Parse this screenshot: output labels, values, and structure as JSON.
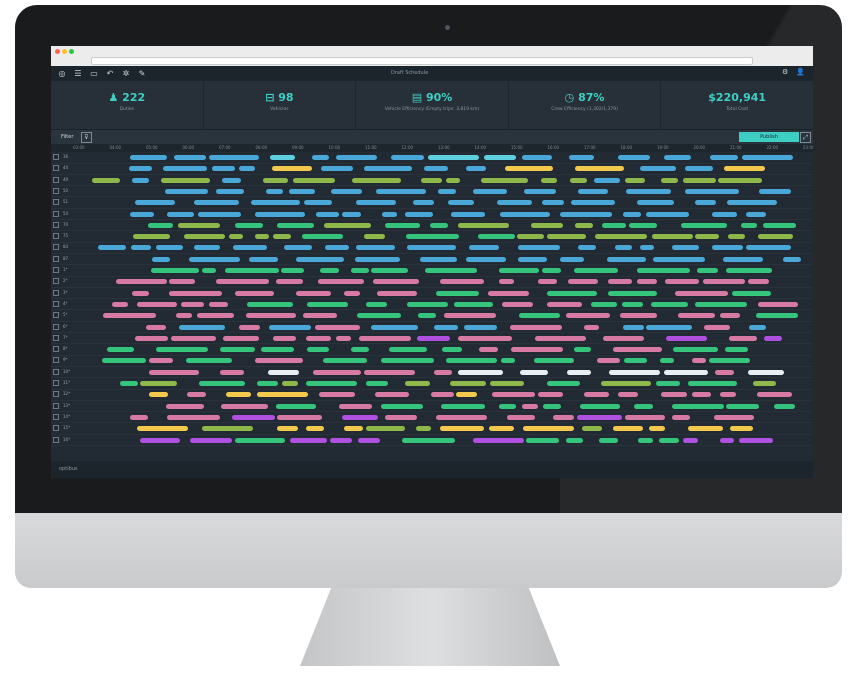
{
  "app": {
    "title": "Draft Schedule",
    "footer_brand": "optibus"
  },
  "toolbar": {
    "icons": [
      "logo-icon",
      "menu-icon",
      "folder-icon",
      "undo-icon",
      "settings-icon",
      "edit-icon"
    ],
    "right_icons": [
      "gear-icon",
      "user-icon"
    ]
  },
  "stats": [
    {
      "value": "222",
      "label": "Duties",
      "icon": "duty-icon"
    },
    {
      "value": "98",
      "label": "Vehicles",
      "icon": "bus-icon"
    },
    {
      "value": "90%",
      "label": "Vehicle Efficiency (Empty trips: 3,819 km)",
      "icon": "gauge-icon"
    },
    {
      "value": "87%",
      "label": "Crew Efficiency (1,302/1,379)",
      "icon": "clock-icon"
    },
    {
      "value": "$220,941",
      "label": "Total Cost",
      "icon": ""
    }
  ],
  "filter": {
    "label": "Filter",
    "button_label": "Publish"
  },
  "time_axis": [
    "03:00",
    "04:00",
    "05:00",
    "06:00",
    "07:00",
    "08:00",
    "09:00",
    "10:00",
    "11:00",
    "12:00",
    "13:00",
    "14:00",
    "15:00",
    "16:00",
    "17:00",
    "18:00",
    "19:00",
    "20:00",
    "21:00",
    "22:00",
    "23:00"
  ],
  "row_labels": [
    "36",
    "44",
    "49",
    "50",
    "51",
    "54",
    "70",
    "75",
    "84",
    "87",
    "1*",
    "2*",
    "3*",
    "4*",
    "5*",
    "6*",
    "7*",
    "8*",
    "9*",
    "10*",
    "11*",
    "12*",
    "13*",
    "14*",
    "15*",
    "16*"
  ],
  "colors": {
    "blue": "#4aa8d8",
    "cyan": "#5fd0e0",
    "green": "#35c47c",
    "olive": "#8fb84a",
    "pink": "#d67aa3",
    "purple": "#b050e0",
    "yellow": "#f2c94c",
    "teal": "#3ecfc4",
    "white": "#e8eef2"
  }
}
